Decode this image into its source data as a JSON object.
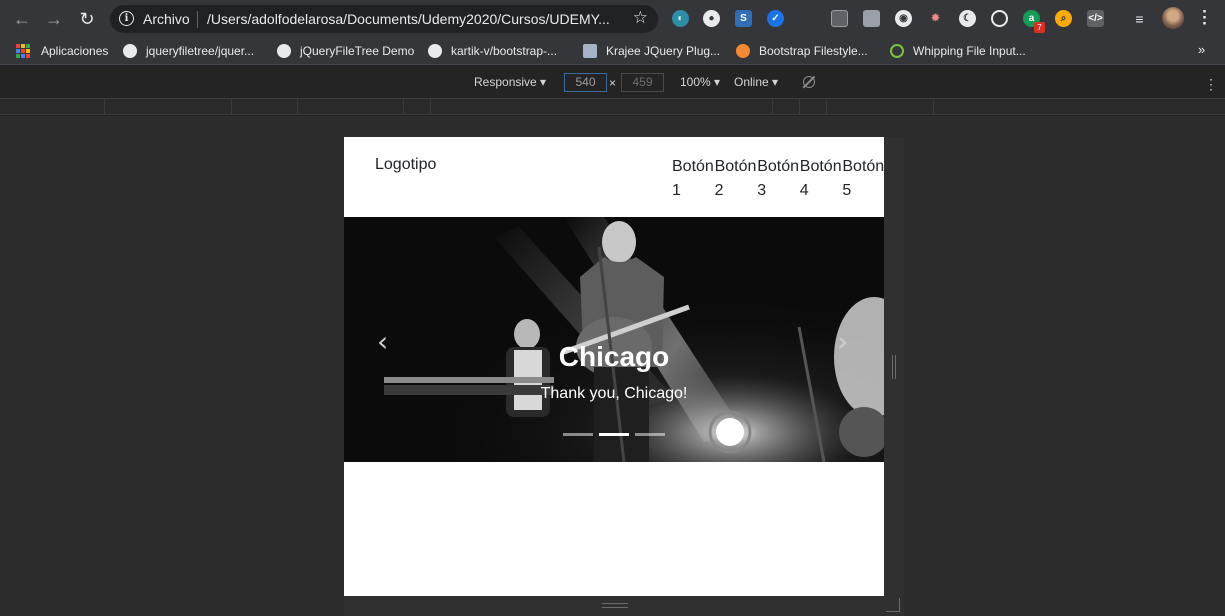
{
  "browser": {
    "address_bar": {
      "security_label": "Archivo",
      "url": "/Users/adolfodelarosa/Documents/Udemy2020/Cursos/UDEMY..."
    },
    "extension_badge": "7",
    "extensions": [
      "crescent-icon",
      "search-badge-icon",
      "s-icon",
      "check-badge-icon",
      "terminal-icon",
      "grid-icon",
      "circle-icon",
      "off-badge-icon",
      "moon-icon",
      "target-icon",
      "a-icon",
      "magnifier-icon",
      "code-icon",
      "playlist-icon"
    ]
  },
  "bookmarks": [
    {
      "label": "Aplicaciones",
      "icon": "apps-grid-icon"
    },
    {
      "label": "jqueryfiletree/jquer...",
      "icon": "github-icon"
    },
    {
      "label": "jQueryFileTree Demo",
      "icon": "globe-icon"
    },
    {
      "label": "kartik-v/bootstrap-...",
      "icon": "github-icon"
    },
    {
      "label": "Krajee JQuery Plug...",
      "icon": "k-icon"
    },
    {
      "label": "Bootstrap Filestyle...",
      "icon": "cherry-icon"
    },
    {
      "label": "Whipping File Input...",
      "icon": "leaf-icon"
    }
  ],
  "devtools": {
    "device": "Responsive ▾",
    "width": "540",
    "times": "×",
    "height": "459",
    "zoom": "100% ▾",
    "network": "Online ▾"
  },
  "site": {
    "logo": "Logotipo",
    "nav": [
      "Botón 1",
      "Botón 2",
      "Botón 3",
      "Botón 4",
      "Botón 5"
    ],
    "carousel": {
      "title": "Chicago",
      "caption": "Thank you, Chicago!",
      "prev": "‹",
      "next": "›",
      "slide_count": 3,
      "active_slide": 2
    }
  },
  "colors": {
    "chrome_toolbar": "#35363a",
    "devtools_bg": "#242424",
    "page_bg": "#ffffff",
    "caption_text": "#ffffff"
  }
}
